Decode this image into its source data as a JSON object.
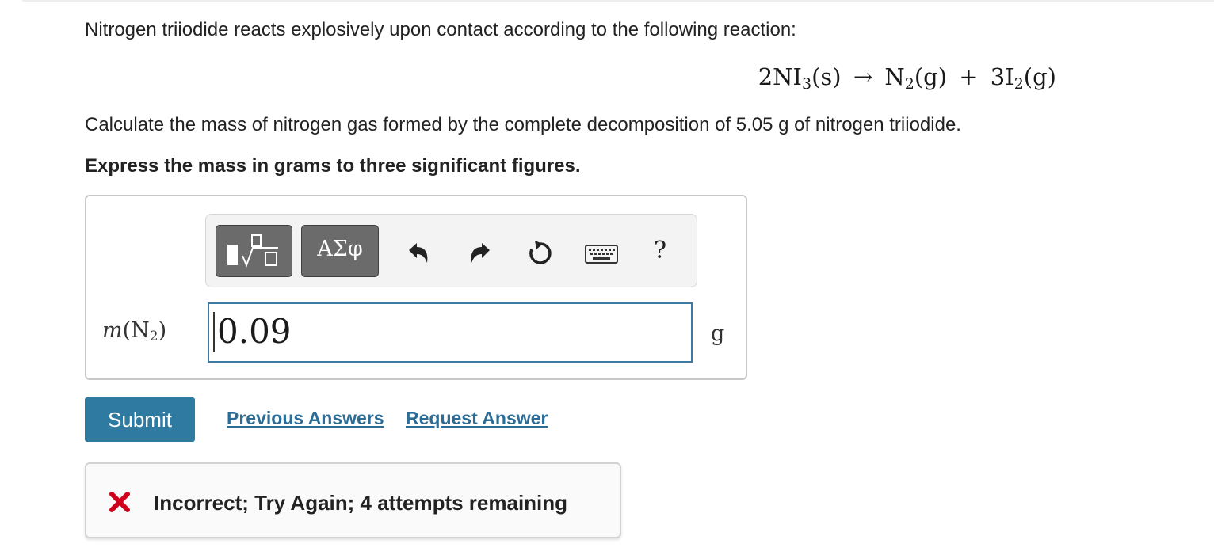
{
  "problem": {
    "prompt": "Nitrogen triiodide reacts explosively upon contact according to the following reaction:",
    "equation": {
      "reactant_coef": "2NI",
      "reactant_sub": "3",
      "reactant_state": "(s)",
      "arrow": "→",
      "product1": "N",
      "product1_sub": "2",
      "product1_state": "(g)",
      "plus": "+",
      "product2": "3I",
      "product2_sub": "2",
      "product2_state": "(g)"
    },
    "question": "Calculate the mass of nitrogen gas formed by the complete decomposition of 5.05 g of nitrogen triiodide.",
    "instruction": "Express the mass in grams to three significant figures."
  },
  "toolbar": {
    "templates_icon": "fraction-sqrt-templates-icon",
    "symbols_label": "ΑΣφ",
    "undo_icon": "undo-icon",
    "redo_icon": "redo-icon",
    "reset_icon": "reset-icon",
    "keyboard_icon": "keyboard-icon",
    "help_label": "?"
  },
  "answer": {
    "variable": "m",
    "variable_open": "(N",
    "variable_sub": "2",
    "variable_close": ")",
    "equals": "=",
    "value": "0.09",
    "unit": "g"
  },
  "actions": {
    "submit_label": "Submit",
    "previous_answers_label": "Previous Answers",
    "request_answer_label": "Request Answer"
  },
  "feedback": {
    "message": "Incorrect; Try Again; 4 attempts remaining",
    "icon": "x-icon",
    "icon_color": "#d0021b"
  },
  "colors": {
    "accent": "#2e7aa0",
    "link": "#2b6d96",
    "input_border": "#3a7aa3"
  }
}
